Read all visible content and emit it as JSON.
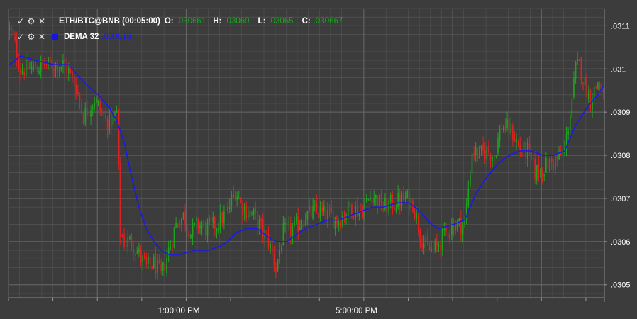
{
  "legend": {
    "controls": {
      "check": "✓",
      "settings": "⚙",
      "close": "✕"
    },
    "series_title": "ETH/BTC@BNB (00:05:00)",
    "ohlc": {
      "o_label": "O:",
      "o_value": ".030661",
      "h_label": "H:",
      "h_value": ".03069",
      "l_label": "L:",
      "l_value": ".03065",
      "c_label": "C:",
      "c_value": ".030667"
    },
    "indicator_title": "DEMA 32",
    "indicator_value": ".030618"
  },
  "colors": {
    "background": "#3c3c3c",
    "grid": "#585858",
    "axis_text": "#ffffff",
    "bull": "#1fa31f",
    "bear": "#e02020",
    "dema": "#1a1ae6",
    "legend_value_green": "#1fa31f",
    "legend_value_blue": "#1a1af0"
  },
  "chart_data": {
    "type": "candlestick",
    "y_ticks": [
      ".0305",
      ".0306",
      ".0307",
      ".0308",
      ".0309",
      ".031",
      ".0311"
    ],
    "y_tick_values": [
      0.0305,
      0.0306,
      0.0307,
      0.0308,
      0.0309,
      0.031,
      0.0311
    ],
    "ylim": [
      0.03047,
      0.03114
    ],
    "x_tick_labels": [
      "1:00:00 PM",
      "5:00:00 PM"
    ],
    "x_tick_label_index": [
      92,
      188
    ],
    "bar_count": 322,
    "grid": true,
    "series": [
      {
        "name": "ETH/BTC@BNB (00:05:00)",
        "kind": "candles"
      },
      {
        "name": "DEMA 32",
        "kind": "line"
      }
    ],
    "close_keyframes": [
      [
        0,
        0.03109
      ],
      [
        2,
        0.03107
      ],
      [
        6,
        0.031
      ],
      [
        12,
        0.031
      ],
      [
        20,
        0.03101
      ],
      [
        30,
        0.03101
      ],
      [
        36,
        0.03096
      ],
      [
        40,
        0.03089
      ],
      [
        46,
        0.03093
      ],
      [
        52,
        0.03088
      ],
      [
        56,
        0.03088
      ],
      [
        58,
        0.0309
      ],
      [
        60,
        0.03062
      ],
      [
        62,
        0.0306
      ],
      [
        66,
        0.0306
      ],
      [
        70,
        0.03057
      ],
      [
        74,
        0.03054
      ],
      [
        78,
        0.03055
      ],
      [
        82,
        0.03052
      ],
      [
        86,
        0.03058
      ],
      [
        90,
        0.03064
      ],
      [
        94,
        0.03066
      ],
      [
        98,
        0.03062
      ],
      [
        102,
        0.03064
      ],
      [
        106,
        0.03063
      ],
      [
        112,
        0.03064
      ],
      [
        118,
        0.03067
      ],
      [
        122,
        0.03072
      ],
      [
        126,
        0.03068
      ],
      [
        132,
        0.03066
      ],
      [
        136,
        0.03063
      ],
      [
        140,
        0.0306
      ],
      [
        144,
        0.03054
      ],
      [
        148,
        0.03062
      ],
      [
        154,
        0.03063
      ],
      [
        160,
        0.03066
      ],
      [
        166,
        0.03067
      ],
      [
        172,
        0.03066
      ],
      [
        178,
        0.03065
      ],
      [
        184,
        0.03068
      ],
      [
        190,
        0.03067
      ],
      [
        196,
        0.03071
      ],
      [
        202,
        0.03068
      ],
      [
        208,
        0.03069
      ],
      [
        214,
        0.0307
      ],
      [
        218,
        0.03069
      ],
      [
        222,
        0.03062
      ],
      [
        226,
        0.03058
      ],
      [
        230,
        0.03058
      ],
      [
        234,
        0.03061
      ],
      [
        240,
        0.03064
      ],
      [
        246,
        0.03064
      ],
      [
        250,
        0.03081
      ],
      [
        254,
        0.0308
      ],
      [
        258,
        0.03081
      ],
      [
        262,
        0.0308
      ],
      [
        266,
        0.03087
      ],
      [
        270,
        0.03086
      ],
      [
        272,
        0.03085
      ],
      [
        276,
        0.03081
      ],
      [
        280,
        0.03081
      ],
      [
        284,
        0.03076
      ],
      [
        288,
        0.03077
      ],
      [
        292,
        0.03078
      ],
      [
        296,
        0.03079
      ],
      [
        300,
        0.03081
      ],
      [
        304,
        0.03093
      ],
      [
        306,
        0.031
      ],
      [
        308,
        0.03101
      ],
      [
        310,
        0.03098
      ],
      [
        314,
        0.03093
      ],
      [
        318,
        0.03097
      ],
      [
        321,
        0.03093
      ]
    ],
    "dema_keyframes": [
      [
        0,
        0.03101
      ],
      [
        6,
        0.03103
      ],
      [
        14,
        0.03102
      ],
      [
        24,
        0.03101
      ],
      [
        32,
        0.03101
      ],
      [
        40,
        0.03097
      ],
      [
        48,
        0.03094
      ],
      [
        54,
        0.03091
      ],
      [
        58,
        0.03088
      ],
      [
        62,
        0.03083
      ],
      [
        66,
        0.03075
      ],
      [
        70,
        0.03068
      ],
      [
        74,
        0.03063
      ],
      [
        78,
        0.0306
      ],
      [
        82,
        0.03058
      ],
      [
        86,
        0.03057
      ],
      [
        92,
        0.03057
      ],
      [
        100,
        0.03058
      ],
      [
        108,
        0.03058
      ],
      [
        114,
        0.03059
      ],
      [
        118,
        0.0306
      ],
      [
        122,
        0.03062
      ],
      [
        128,
        0.03063
      ],
      [
        134,
        0.03063
      ],
      [
        140,
        0.03061
      ],
      [
        144,
        0.0306
      ],
      [
        150,
        0.0306
      ],
      [
        156,
        0.03062
      ],
      [
        160,
        0.03063
      ],
      [
        166,
        0.03064
      ],
      [
        172,
        0.03065
      ],
      [
        178,
        0.03065
      ],
      [
        184,
        0.03066
      ],
      [
        190,
        0.03067
      ],
      [
        196,
        0.03068
      ],
      [
        202,
        0.03068
      ],
      [
        210,
        0.03069
      ],
      [
        216,
        0.03069
      ],
      [
        222,
        0.03067
      ],
      [
        228,
        0.03064
      ],
      [
        232,
        0.03063
      ],
      [
        240,
        0.03064
      ],
      [
        246,
        0.03065
      ],
      [
        252,
        0.03071
      ],
      [
        258,
        0.03075
      ],
      [
        264,
        0.03078
      ],
      [
        270,
        0.0308
      ],
      [
        276,
        0.03081
      ],
      [
        282,
        0.03081
      ],
      [
        288,
        0.0308
      ],
      [
        294,
        0.0308
      ],
      [
        300,
        0.03081
      ],
      [
        306,
        0.03087
      ],
      [
        312,
        0.03091
      ],
      [
        318,
        0.03094
      ],
      [
        321,
        0.03096
      ]
    ]
  }
}
